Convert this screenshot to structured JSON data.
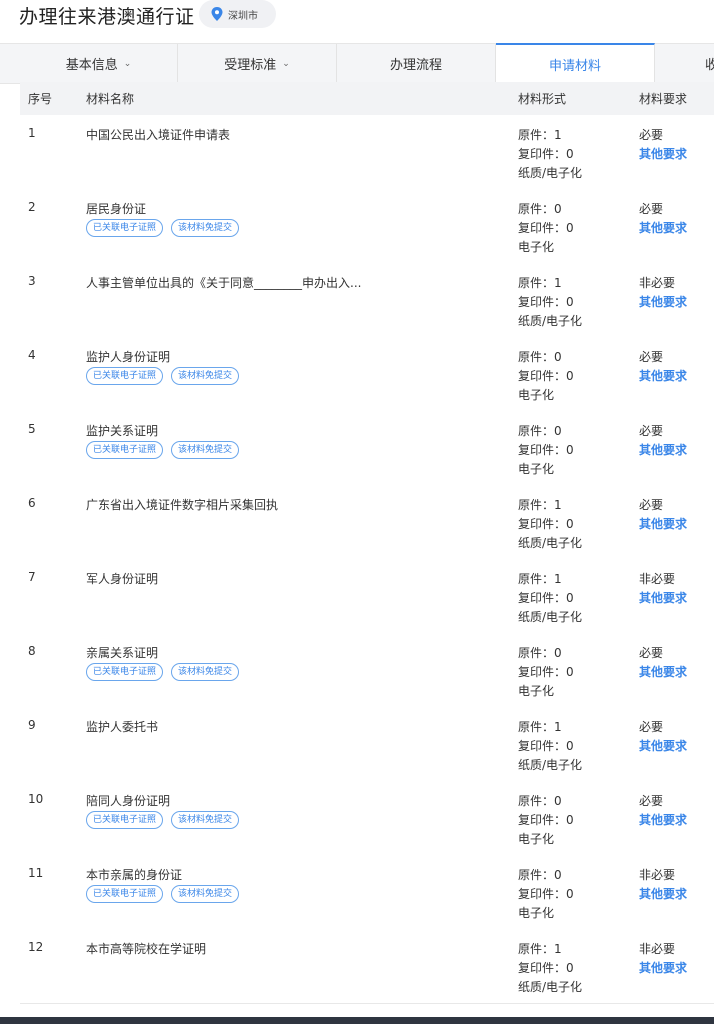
{
  "header": {
    "title": "办理往来港澳通行证",
    "location": "深圳市"
  },
  "tabs": [
    {
      "label": "基本信息",
      "dropdown": true
    },
    {
      "label": "受理标准",
      "dropdown": true
    },
    {
      "label": "办理流程",
      "dropdown": false
    },
    {
      "label": "申请材料",
      "dropdown": false,
      "active": true
    },
    {
      "label": "收",
      "dropdown": false
    }
  ],
  "table": {
    "headers": {
      "seq": "序号",
      "name": "材料名称",
      "form": "材料形式",
      "req": "材料要求"
    },
    "badge_linked": "已关联电子证照",
    "badge_exempt": "该材料免提交",
    "other_req": "其他要求",
    "rows": [
      {
        "seq": "1",
        "name": "中国公民出入境证件申请表",
        "badges": false,
        "original": "原件：1",
        "copy": "复印件：0",
        "medium": "纸质/电子化",
        "necessity": "必要"
      },
      {
        "seq": "2",
        "name": "居民身份证",
        "badges": true,
        "original": "原件：0",
        "copy": "复印件：0",
        "medium": "电子化",
        "necessity": "必要"
      },
      {
        "seq": "3",
        "name": "人事主管单位出具的《关于同意________申办出入...",
        "badges": false,
        "original": "原件：1",
        "copy": "复印件：0",
        "medium": "纸质/电子化",
        "necessity": "非必要"
      },
      {
        "seq": "4",
        "name": "监护人身份证明",
        "badges": true,
        "original": "原件：0",
        "copy": "复印件：0",
        "medium": "电子化",
        "necessity": "必要"
      },
      {
        "seq": "5",
        "name": "监护关系证明",
        "badges": true,
        "original": "原件：0",
        "copy": "复印件：0",
        "medium": "电子化",
        "necessity": "必要"
      },
      {
        "seq": "6",
        "name": "广东省出入境证件数字相片采集回执",
        "badges": false,
        "original": "原件：1",
        "copy": "复印件：0",
        "medium": "纸质/电子化",
        "necessity": "必要"
      },
      {
        "seq": "7",
        "name": "军人身份证明",
        "badges": false,
        "original": "原件：1",
        "copy": "复印件：0",
        "medium": "纸质/电子化",
        "necessity": "非必要"
      },
      {
        "seq": "8",
        "name": "亲属关系证明",
        "badges": true,
        "original": "原件：0",
        "copy": "复印件：0",
        "medium": "电子化",
        "necessity": "必要"
      },
      {
        "seq": "9",
        "name": "监护人委托书",
        "badges": false,
        "original": "原件：1",
        "copy": "复印件：0",
        "medium": "纸质/电子化",
        "necessity": "必要"
      },
      {
        "seq": "10",
        "name": "陪同人身份证明",
        "badges": true,
        "original": "原件：0",
        "copy": "复印件：0",
        "medium": "电子化",
        "necessity": "必要"
      },
      {
        "seq": "11",
        "name": "本市亲属的身份证",
        "badges": true,
        "original": "原件：0",
        "copy": "复印件：0",
        "medium": "电子化",
        "necessity": "非必要"
      },
      {
        "seq": "12",
        "name": "本市高等院校在学证明",
        "badges": false,
        "original": "原件：1",
        "copy": "复印件：0",
        "medium": "纸质/电子化",
        "necessity": "非必要"
      }
    ]
  },
  "colors": {
    "accent": "#3a86e8",
    "footer": "#2f3540"
  }
}
